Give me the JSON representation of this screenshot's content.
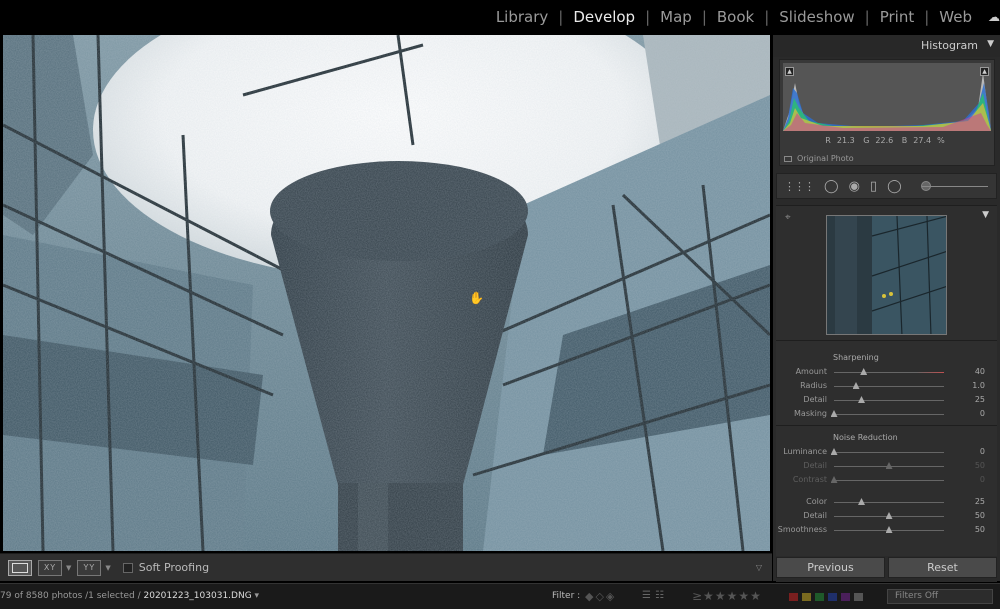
{
  "modules": {
    "items": [
      "Library",
      "Develop",
      "Map",
      "Book",
      "Slideshow",
      "Print",
      "Web"
    ],
    "active": "Develop"
  },
  "histogram": {
    "title": "Histogram",
    "r_label": "R",
    "r_value": "21.3",
    "g_label": "G",
    "g_value": "22.6",
    "b_label": "B",
    "b_value": "27.4",
    "unit": "%",
    "original_photo_label": "Original Photo"
  },
  "sharpening": {
    "title": "Sharpening",
    "sliders": [
      {
        "label": "Amount",
        "value": "40",
        "pos": 0.27
      },
      {
        "label": "Radius",
        "value": "1.0",
        "pos": 0.2
      },
      {
        "label": "Detail",
        "value": "25",
        "pos": 0.25
      },
      {
        "label": "Masking",
        "value": "0",
        "pos": 0.0
      }
    ]
  },
  "noise_reduction": {
    "title": "Noise Reduction",
    "luminance": [
      {
        "label": "Luminance",
        "value": "0",
        "pos": 0.0,
        "dim": false
      },
      {
        "label": "Detail",
        "value": "50",
        "pos": 0.5,
        "dim": true
      },
      {
        "label": "Contrast",
        "value": "0",
        "pos": 0.0,
        "dim": true
      }
    ],
    "color": [
      {
        "label": "Color",
        "value": "25",
        "pos": 0.25,
        "dim": false
      },
      {
        "label": "Detail",
        "value": "50",
        "pos": 0.5,
        "dim": false
      },
      {
        "label": "Smoothness",
        "value": "50",
        "pos": 0.5,
        "dim": false
      }
    ]
  },
  "buttons": {
    "previous": "Previous",
    "reset": "Reset"
  },
  "toolbar": {
    "soft_proofing": "Soft Proofing",
    "compare_label": "YY",
    "survey_label": "XY"
  },
  "filmstrip": {
    "count_text": "79 of 8580 photos /1 selected /",
    "filename": "20201223_103031.DNG",
    "filter_label": "Filter :",
    "filters_select": "Filters Off"
  },
  "colors": {
    "accent_red": "#c05050",
    "panel_bg": "#2a2a2a"
  }
}
